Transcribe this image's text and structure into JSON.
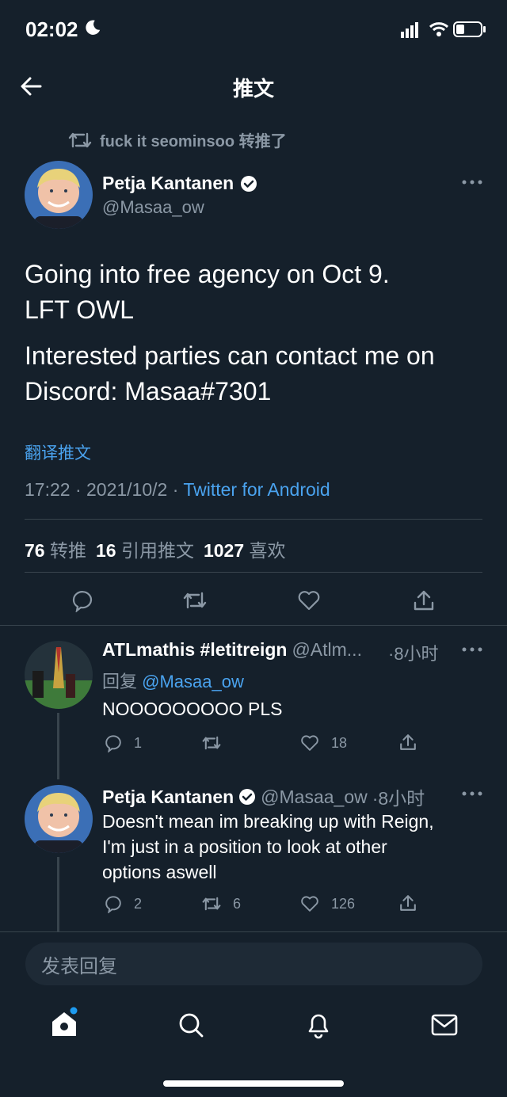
{
  "status_bar": {
    "time": "02:02"
  },
  "header": {
    "title": "推文"
  },
  "retweet": {
    "text": "fuck it seominsoo 转推了"
  },
  "tweet": {
    "author_name": "Petja Kantanen",
    "author_handle": "@Masaa_ow",
    "line1": "Going into free agency on Oct 9.",
    "line2": "LFT OWL",
    "line3": "Interested parties can contact me on",
    "line4": "Discord: Masaa#7301",
    "translate": "翻译推文",
    "timestamp": "17:22 · 2021/10/2 · ",
    "source": "Twitter for Android",
    "stats": {
      "retweets_count": "76",
      "retweets_label": "转推",
      "quotes_count": "16",
      "quotes_label": "引用推文",
      "likes_count": "1027",
      "likes_label": "喜欢"
    }
  },
  "replies": [
    {
      "author_name": "ATLmathis #letitreign",
      "author_handle": "@Atlm...",
      "time": "·8小时",
      "reply_prefix": "回复",
      "reply_to": "@Masaa_ow",
      "lines": [
        "NOOOOOOOOO PLS"
      ],
      "counts": {
        "replies": "1",
        "retweets": "",
        "likes": "18"
      }
    },
    {
      "author_name": "Petja Kantanen",
      "author_handle": "@Masaa_ow",
      "time": "·8小时",
      "lines": [
        "Doesn't mean im breaking up with Reign,",
        "I'm just in a position to look at other",
        "options aswell"
      ],
      "counts": {
        "replies": "2",
        "retweets": "6",
        "likes": "126"
      }
    }
  ],
  "composer": {
    "placeholder": "发表回复"
  },
  "icons": {
    "back": "arrow-left-icon",
    "retweet": "retweet-icon",
    "verified": "verified-badge-icon",
    "more": "more-icon",
    "reply": "reply-icon",
    "like": "heart-icon",
    "share": "share-icon",
    "home": "home-icon",
    "search": "search-icon",
    "notifications": "bell-icon",
    "messages": "mail-icon"
  },
  "colors": {
    "background": "#15202b",
    "accent": "#1d9bf0",
    "muted": "#8b98a5"
  }
}
